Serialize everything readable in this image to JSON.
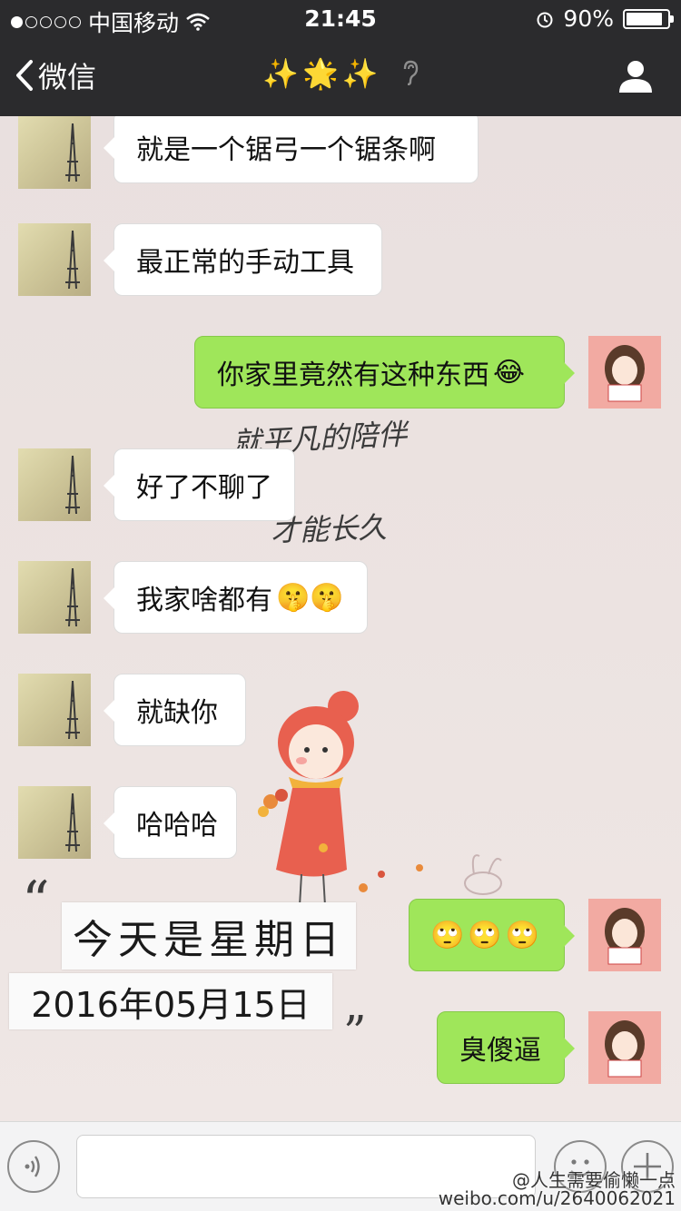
{
  "status_bar": {
    "carrier": "中国移动",
    "time": "21:45",
    "battery_percent": "90%",
    "battery_level": 0.9
  },
  "nav": {
    "back_label": "微信",
    "title": "✨🌟✨"
  },
  "messages": [
    {
      "side": "in",
      "text": "就是一个锯弓一个锯条啊",
      "emoji": ""
    },
    {
      "side": "in",
      "text": "最正常的手动工具",
      "emoji": ""
    },
    {
      "side": "out",
      "text": "你家里竟然有这种东西",
      "emoji": "😂"
    },
    {
      "side": "in",
      "text": "好了不聊了",
      "emoji": ""
    },
    {
      "side": "in",
      "text": "我家啥都有",
      "emoji": "🤫🤫"
    },
    {
      "side": "in",
      "text": "就缺你",
      "emoji": ""
    },
    {
      "side": "in",
      "text": "哈哈哈",
      "emoji": ""
    },
    {
      "side": "out",
      "text": "",
      "emoji": "🙄🙄🙄"
    },
    {
      "side": "out",
      "text": "臭傻逼",
      "emoji": ""
    }
  ],
  "background": {
    "handwriting_line1": "就平凡的陪伴",
    "handwriting_line2": "才能长久",
    "quote_open": "“",
    "quote_close": "”",
    "date_line1": "今天是星期日",
    "date_line2": "2016年05月15日"
  },
  "watermark": {
    "line1": "@人生需要偷懒一点",
    "line2": "weibo.com/u/2640062021"
  },
  "icons": {
    "voice": "voice-icon",
    "emoji": "emoji-icon",
    "plus": "plus-icon"
  }
}
